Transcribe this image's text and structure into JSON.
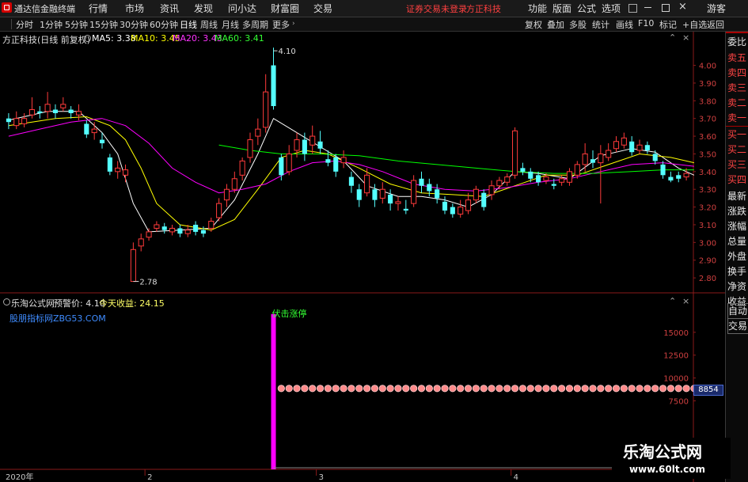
{
  "app": {
    "name": "通达信金融终端",
    "menu": [
      "行情",
      "市场",
      "资讯",
      "发现",
      "问小达",
      "财富圈",
      "交易"
    ],
    "notice": "证券交易未登录",
    "broker": "方正科技",
    "right_menu": [
      "功能",
      "版面",
      "公式",
      "选项"
    ],
    "user": "游客"
  },
  "toolbar": {
    "periods": [
      "分时",
      "1分钟",
      "5分钟",
      "15分钟",
      "30分钟",
      "60分钟",
      "日线",
      "周线",
      "月线",
      "多周期",
      "更多"
    ],
    "active": "日线",
    "actions": [
      "复权",
      "叠加",
      "多股",
      "统计",
      "画线",
      "F10",
      "标记",
      "+自选",
      "返回"
    ]
  },
  "price_panel": {
    "stock": "方正科技(日线 前复权)",
    "ma": [
      {
        "label": "MA5: 3.38",
        "color": "#ffffff"
      },
      {
        "label": "MA10: 3.45",
        "color": "#ffff00"
      },
      {
        "label": "MA20: 3.43",
        "color": "#ff00ff"
      },
      {
        "label": "MA60: 3.41",
        "color": "#00ff00"
      }
    ],
    "high_label": "4.10",
    "low_label": "2.78"
  },
  "indicator_panel": {
    "name": "乐淘公式网",
    "warn_label": "预警价: 4.10",
    "gain_label": "今天收益: 24.15",
    "link": "股朋指标网ZBG53.COM",
    "signal": "伏击涨停",
    "value_tag": "8854",
    "y_ticks": [
      15000,
      12500,
      10000,
      7500
    ]
  },
  "x_axis": [
    "2020年",
    "2",
    "3",
    "4"
  ],
  "right_panel": [
    "委比",
    "卖五",
    "卖四",
    "卖三",
    "卖二",
    "卖一",
    "买一",
    "买二",
    "买三",
    "买四",
    "最新",
    "涨跌",
    "涨幅",
    "总量",
    "外盘",
    "换手",
    "净资",
    "收益",
    "自动",
    "交易"
  ],
  "watermark": {
    "title": "乐淘公式网",
    "url": "www.60lt.com"
  },
  "chart_data": {
    "type": "candlestick",
    "ylim": [
      2.72,
      4.15
    ],
    "y_ticks": [
      4.0,
      3.9,
      3.8,
      3.7,
      3.6,
      3.5,
      3.4,
      3.3,
      3.2,
      3.1,
      3.0,
      2.9,
      2.8
    ],
    "candles": [
      [
        3.7,
        3.68,
        3.73,
        3.64
      ],
      [
        3.66,
        3.7,
        3.74,
        3.64
      ],
      [
        3.67,
        3.7,
        3.73,
        3.65
      ],
      [
        3.72,
        3.75,
        3.82,
        3.7
      ],
      [
        3.74,
        3.73,
        3.77,
        3.7
      ],
      [
        3.74,
        3.78,
        3.85,
        3.7
      ],
      [
        3.75,
        3.73,
        3.78,
        3.7
      ],
      [
        3.76,
        3.78,
        3.82,
        3.74
      ],
      [
        3.75,
        3.73,
        3.77,
        3.7
      ],
      [
        3.72,
        3.74,
        3.78,
        3.69
      ],
      [
        3.67,
        3.61,
        3.69,
        3.59
      ],
      [
        3.62,
        3.64,
        3.68,
        3.58
      ],
      [
        3.58,
        3.56,
        3.62,
        3.53
      ],
      [
        3.48,
        3.4,
        3.5,
        3.38
      ],
      [
        3.4,
        3.42,
        3.46,
        3.36
      ],
      [
        3.38,
        3.41,
        3.44,
        3.34
      ],
      [
        2.78,
        2.96,
        3.0,
        2.78
      ],
      [
        2.98,
        3.02,
        3.05,
        2.95
      ],
      [
        3.03,
        3.06,
        3.08,
        3.01
      ],
      [
        3.08,
        3.1,
        3.12,
        3.06
      ],
      [
        3.09,
        3.07,
        3.11,
        3.05
      ],
      [
        3.06,
        3.08,
        3.1,
        3.04
      ],
      [
        3.08,
        3.05,
        3.1,
        3.03
      ],
      [
        3.05,
        3.07,
        3.1,
        3.03
      ],
      [
        3.1,
        3.06,
        3.12,
        3.04
      ],
      [
        3.07,
        3.05,
        3.09,
        3.03
      ],
      [
        3.08,
        3.12,
        3.14,
        3.06
      ],
      [
        3.14,
        3.22,
        3.25,
        3.12
      ],
      [
        3.24,
        3.3,
        3.33,
        3.2
      ],
      [
        3.3,
        3.36,
        3.4,
        3.28
      ],
      [
        3.38,
        3.46,
        3.48,
        3.35
      ],
      [
        3.48,
        3.58,
        3.62,
        3.45
      ],
      [
        3.6,
        3.64,
        3.7,
        3.55
      ],
      [
        3.65,
        3.85,
        3.95,
        3.62
      ],
      [
        4.0,
        3.77,
        4.1,
        3.75
      ],
      [
        3.48,
        3.38,
        3.5,
        3.35
      ],
      [
        3.4,
        3.5,
        3.55,
        3.38
      ],
      [
        3.52,
        3.58,
        3.62,
        3.48
      ],
      [
        3.58,
        3.5,
        3.62,
        3.46
      ],
      [
        3.55,
        3.6,
        3.66,
        3.5
      ],
      [
        3.57,
        3.53,
        3.63,
        3.5
      ],
      [
        3.47,
        3.45,
        3.52,
        3.43
      ],
      [
        3.48,
        3.4,
        3.5,
        3.37
      ],
      [
        3.45,
        3.48,
        3.52,
        3.42
      ],
      [
        3.37,
        3.32,
        3.4,
        3.28
      ],
      [
        3.3,
        3.24,
        3.33,
        3.2
      ],
      [
        3.28,
        3.38,
        3.42,
        3.26
      ],
      [
        3.3,
        3.24,
        3.33,
        3.2
      ],
      [
        3.25,
        3.3,
        3.34,
        3.22
      ],
      [
        3.27,
        3.22,
        3.3,
        3.18
      ],
      [
        3.22,
        3.23,
        3.26,
        3.18
      ],
      [
        3.19,
        3.18,
        3.24,
        3.16
      ],
      [
        3.22,
        3.35,
        3.38,
        3.2
      ],
      [
        3.36,
        3.32,
        3.4,
        3.28
      ],
      [
        3.33,
        3.29,
        3.36,
        3.26
      ],
      [
        3.3,
        3.25,
        3.33,
        3.22
      ],
      [
        3.23,
        3.18,
        3.26,
        3.16
      ],
      [
        3.2,
        3.16,
        3.22,
        3.14
      ],
      [
        3.16,
        3.2,
        3.24,
        3.14
      ],
      [
        3.18,
        3.24,
        3.28,
        3.16
      ],
      [
        3.24,
        3.3,
        3.32,
        3.22
      ],
      [
        3.28,
        3.2,
        3.3,
        3.18
      ],
      [
        3.27,
        3.32,
        3.35,
        3.24
      ],
      [
        3.32,
        3.35,
        3.37,
        3.3
      ],
      [
        3.34,
        3.37,
        3.39,
        3.32
      ],
      [
        3.38,
        3.63,
        3.65,
        3.36
      ],
      [
        3.42,
        3.4,
        3.45,
        3.38
      ],
      [
        3.4,
        3.36,
        3.42,
        3.34
      ],
      [
        3.38,
        3.34,
        3.4,
        3.32
      ],
      [
        3.35,
        3.37,
        3.39,
        3.33
      ],
      [
        3.33,
        3.32,
        3.36,
        3.3
      ],
      [
        3.34,
        3.36,
        3.38,
        3.32
      ],
      [
        3.34,
        3.4,
        3.42,
        3.32
      ],
      [
        3.38,
        3.44,
        3.46,
        3.36
      ],
      [
        3.44,
        3.5,
        3.56,
        3.4
      ],
      [
        3.47,
        3.45,
        3.52,
        3.42
      ],
      [
        3.45,
        3.5,
        3.55,
        3.22
      ],
      [
        3.48,
        3.52,
        3.56,
        3.46
      ],
      [
        3.53,
        3.57,
        3.6,
        3.51
      ],
      [
        3.55,
        3.59,
        3.62,
        3.53
      ],
      [
        3.57,
        3.51,
        3.6,
        3.49
      ],
      [
        3.52,
        3.55,
        3.58,
        3.5
      ],
      [
        3.55,
        3.52,
        3.57,
        3.5
      ],
      [
        3.5,
        3.46,
        3.52,
        3.44
      ],
      [
        3.44,
        3.38,
        3.46,
        3.36
      ],
      [
        3.37,
        3.35,
        3.4,
        3.34
      ],
      [
        3.38,
        3.36,
        3.4,
        3.34
      ],
      [
        3.37,
        3.39,
        3.42,
        3.35
      ]
    ],
    "ma_series": [
      {
        "name": "MA5",
        "color": "#ffffff",
        "points": [
          [
            0,
            3.69
          ],
          [
            5,
            3.74
          ],
          [
            9,
            3.74
          ],
          [
            12,
            3.62
          ],
          [
            14,
            3.5
          ],
          [
            16,
            3.22
          ],
          [
            18,
            3.06
          ],
          [
            22,
            3.07
          ],
          [
            26,
            3.08
          ],
          [
            29,
            3.24
          ],
          [
            32,
            3.5
          ],
          [
            34,
            3.7
          ],
          [
            37,
            3.62
          ],
          [
            40,
            3.54
          ],
          [
            43,
            3.46
          ],
          [
            46,
            3.32
          ],
          [
            50,
            3.26
          ],
          [
            53,
            3.26
          ],
          [
            56,
            3.24
          ],
          [
            59,
            3.2
          ],
          [
            62,
            3.27
          ],
          [
            65,
            3.4
          ],
          [
            68,
            3.39
          ],
          [
            72,
            3.36
          ],
          [
            76,
            3.49
          ],
          [
            80,
            3.53
          ],
          [
            83,
            3.51
          ],
          [
            86,
            3.42
          ],
          [
            88,
            3.38
          ]
        ]
      },
      {
        "name": "MA10",
        "color": "#ffff00",
        "points": [
          [
            0,
            3.66
          ],
          [
            6,
            3.7
          ],
          [
            10,
            3.71
          ],
          [
            13,
            3.66
          ],
          [
            15,
            3.58
          ],
          [
            17,
            3.42
          ],
          [
            19,
            3.22
          ],
          [
            22,
            3.1
          ],
          [
            26,
            3.07
          ],
          [
            29,
            3.13
          ],
          [
            32,
            3.3
          ],
          [
            35,
            3.48
          ],
          [
            38,
            3.52
          ],
          [
            41,
            3.5
          ],
          [
            45,
            3.42
          ],
          [
            49,
            3.33
          ],
          [
            53,
            3.28
          ],
          [
            57,
            3.27
          ],
          [
            61,
            3.26
          ],
          [
            65,
            3.32
          ],
          [
            69,
            3.38
          ],
          [
            73,
            3.38
          ],
          [
            77,
            3.44
          ],
          [
            81,
            3.5
          ],
          [
            85,
            3.48
          ],
          [
            88,
            3.45
          ]
        ]
      },
      {
        "name": "MA20",
        "color": "#ff00ff",
        "points": [
          [
            0,
            3.6
          ],
          [
            4,
            3.64
          ],
          [
            8,
            3.68
          ],
          [
            12,
            3.7
          ],
          [
            15,
            3.66
          ],
          [
            18,
            3.56
          ],
          [
            21,
            3.42
          ],
          [
            24,
            3.34
          ],
          [
            27,
            3.28
          ],
          [
            30,
            3.3
          ],
          [
            33,
            3.33
          ],
          [
            36,
            3.4
          ],
          [
            39,
            3.45
          ],
          [
            42,
            3.46
          ],
          [
            45,
            3.44
          ],
          [
            48,
            3.4
          ],
          [
            52,
            3.33
          ],
          [
            56,
            3.3
          ],
          [
            60,
            3.29
          ],
          [
            64,
            3.31
          ],
          [
            68,
            3.34
          ],
          [
            72,
            3.36
          ],
          [
            76,
            3.4
          ],
          [
            80,
            3.44
          ],
          [
            84,
            3.45
          ],
          [
            88,
            3.43
          ]
        ]
      },
      {
        "name": "MA60",
        "color": "#00ff00",
        "points": [
          [
            27,
            3.55
          ],
          [
            31,
            3.52
          ],
          [
            35,
            3.5
          ],
          [
            40,
            3.5
          ],
          [
            45,
            3.49
          ],
          [
            50,
            3.46
          ],
          [
            55,
            3.44
          ],
          [
            60,
            3.42
          ],
          [
            65,
            3.4
          ],
          [
            70,
            3.39
          ],
          [
            75,
            3.39
          ],
          [
            80,
            3.4
          ],
          [
            84,
            3.41
          ],
          [
            88,
            3.41
          ]
        ]
      }
    ],
    "indicator": {
      "type": "bar",
      "ylim": [
        0,
        17500
      ],
      "spike_index": 34,
      "spike_value": 17000,
      "baseline_value": 8854,
      "dots_from": 35,
      "dots_to": 88
    }
  }
}
